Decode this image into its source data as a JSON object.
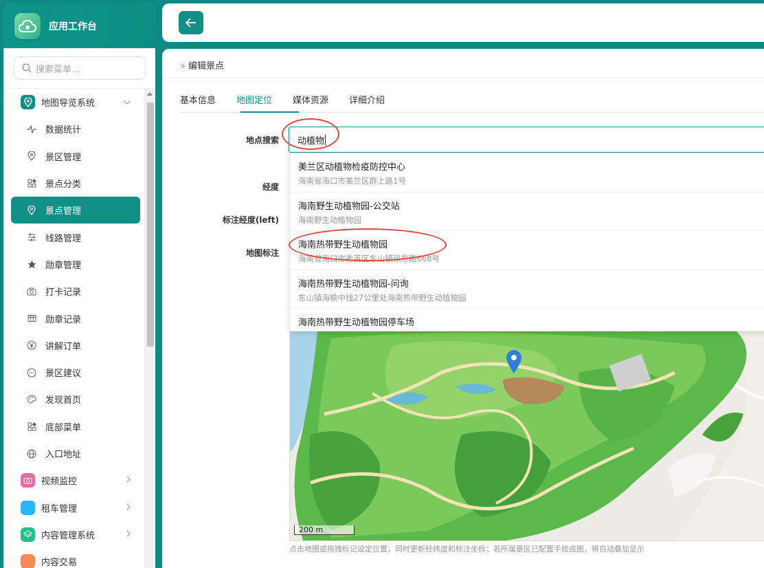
{
  "app": {
    "title": "应用工作台"
  },
  "sidebar": {
    "search_placeholder": "搜索菜单...",
    "groups": [
      {
        "label": "地图导览系统",
        "color": "#108f86",
        "expanded": true
      },
      {
        "label": "视频监控",
        "color": "#e86aa3"
      },
      {
        "label": "租车管理",
        "color": "#29b6f6"
      },
      {
        "label": "内容管理系统",
        "color": "#22c08a"
      },
      {
        "label": "内容交易",
        "color": "#f28a5a"
      }
    ],
    "items": [
      {
        "label": "数据统计",
        "icon": "activity-icon"
      },
      {
        "label": "景区管理",
        "icon": "location-pin-icon"
      },
      {
        "label": "景点分类",
        "icon": "grid-icon"
      },
      {
        "label": "景点管理",
        "icon": "location-pin-icon",
        "active": true
      },
      {
        "label": "线路管理",
        "icon": "sliders-icon"
      },
      {
        "label": "勋章管理",
        "icon": "star-icon"
      },
      {
        "label": "打卡记录",
        "icon": "camera-icon"
      },
      {
        "label": "勋章记录",
        "icon": "table-icon"
      },
      {
        "label": "讲解订单",
        "icon": "yen-icon"
      },
      {
        "label": "景区建议",
        "icon": "chat-icon"
      },
      {
        "label": "发现首页",
        "icon": "palette-icon"
      },
      {
        "label": "底部菜单",
        "icon": "grid-icon"
      },
      {
        "label": "入口地址",
        "icon": "globe-icon"
      }
    ]
  },
  "breadcrumb": {
    "current": "编辑景点"
  },
  "tabs": [
    {
      "label": "基本信息"
    },
    {
      "label": "地图定位",
      "active": true
    },
    {
      "label": "媒体资源"
    },
    {
      "label": "详细介绍"
    }
  ],
  "form": {
    "search_label": "地点搜索",
    "search_value": "动植物",
    "lng_label": "经度",
    "mark_lng_label": "标注经度(left)",
    "map_label": "地图标注"
  },
  "suggestions": [
    {
      "name": "美兰区动植物检疫防控中心",
      "address": "海南省海口市美兰区群上路1号"
    },
    {
      "name": "海南野生动植物园-公交站",
      "address": "海南野生动植物园"
    },
    {
      "name": "海南热带野生动植物园",
      "address": "海南省海口市秀英区东山镇琼东路668号"
    },
    {
      "name": "海南热带野生动植物园-问询",
      "address": "东山镇海榆中线27公里处海南热带野生动植物园"
    },
    {
      "name": "海南热带野生动植物园停车场",
      "address": ""
    }
  ],
  "map": {
    "scale_label": "200 m",
    "marker_color": "#2f7fd8"
  },
  "hint": "点击地图或拖拽标记设定位置，同时更新经纬度和标注坐标；若所属景区已配置手绘底图，将自动叠加显示",
  "colors": {
    "brand": "#108f86",
    "highlight": "#e2463a"
  }
}
